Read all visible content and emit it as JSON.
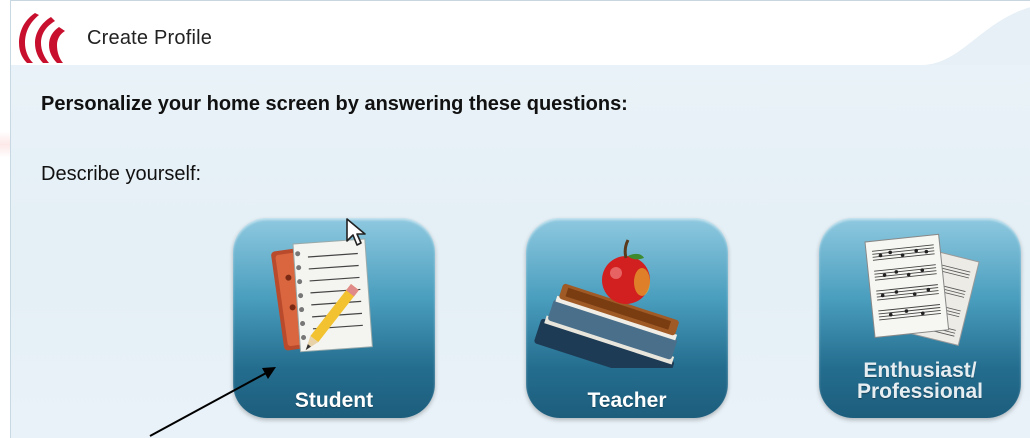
{
  "window": {
    "title": "Create Profile",
    "logo_icon": "cc-logo-icon"
  },
  "main": {
    "heading": "Personalize your home screen by answering these questions:",
    "prompt": "Describe yourself:",
    "options": [
      {
        "label": "Student",
        "icon": "notebook-pencil-icon"
      },
      {
        "label": "Teacher",
        "icon": "books-apple-icon"
      },
      {
        "label_line1": "Enthusiast/",
        "label_line2": "Professional",
        "icon": "sheet-music-icon"
      }
    ]
  },
  "colors": {
    "logo_red": "#c8102e",
    "tile_top": "#8fc9e0",
    "tile_bottom": "#1d5d7c",
    "background": "#e6f0f6"
  }
}
